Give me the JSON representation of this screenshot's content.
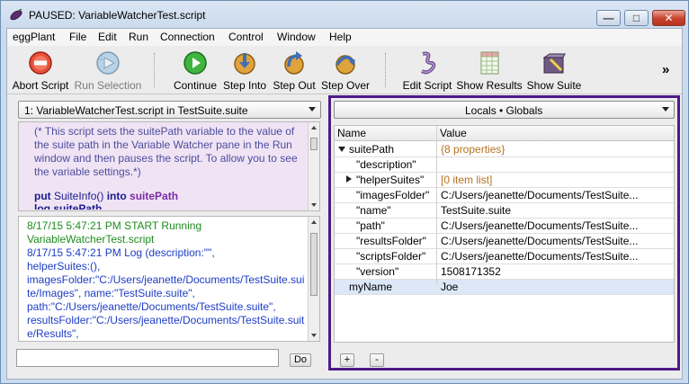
{
  "window": {
    "title": "PAUSED: VariableWatcherTest.script",
    "minimize_label": "—",
    "maximize_label": "□",
    "close_label": "✕"
  },
  "menu": [
    "eggPlant",
    "File",
    "Edit",
    "Run",
    "Connection",
    "Control",
    "Window",
    "Help"
  ],
  "toolbar": {
    "abort": "Abort Script",
    "run_selection": "Run Selection",
    "continue": "Continue",
    "step_into": "Step Into",
    "step_out": "Step Out",
    "step_over": "Step Over",
    "edit_script": "Edit Script",
    "show_results": "Show Results",
    "show_suite": "Show Suite",
    "more": "»"
  },
  "script_selector": {
    "value": "1: VariableWatcherTest.script in TestSuite.suite"
  },
  "script": {
    "comment": "(* This script sets the suitePath variable to the value of the suite path in the Variable Watcher pane in the Run window and then pauses the script. To allow you to see the variable settings.*)",
    "code_kw_put": "put",
    "code_func": "SuiteInfo()",
    "code_kw_into": "into",
    "code_var": "suitePath",
    "code_next": "log suitePath"
  },
  "log": {
    "lines": [
      {
        "text": "8/17/15 5:47:21 PM        START                 Running",
        "color": "green"
      },
      {
        "text": "VariableWatcherTest.script",
        "color": "green"
      },
      {
        "text": "8/17/15 5:47:21 PM        Log             (description:\"\",",
        "color": "blue"
      },
      {
        "text": "helperSuites:(),",
        "color": "blue"
      },
      {
        "text": "imagesFolder:\"C:/Users/jeanette/Documents/TestSuite.sui",
        "color": "blue"
      },
      {
        "text": "te/Images\", name:\"TestSuite.suite\",",
        "color": "blue"
      },
      {
        "text": "path:\"C:/Users/jeanette/Documents/TestSuite.suite\",",
        "color": "blue"
      },
      {
        "text": "resultsFolder:\"C:/Users/jeanette/Documents/TestSuite.suit",
        "color": "blue"
      },
      {
        "text": "e/Results\",",
        "color": "blue"
      }
    ]
  },
  "command": {
    "do_label": "Do"
  },
  "watcher": {
    "scope_selector": "Locals • Globals",
    "col_name": "Name",
    "col_value": "Value",
    "rows": [
      {
        "name": "suitePath",
        "value": "{8 properties}",
        "indent": 0,
        "toggle": "expanded",
        "value_color": "brown"
      },
      {
        "name": "\"description\"",
        "value": "",
        "indent": 1
      },
      {
        "name": "\"helperSuites\"",
        "value": "[0 item list]",
        "indent": 1,
        "toggle": "collapsed",
        "value_color": "brown"
      },
      {
        "name": "\"imagesFolder\"",
        "value": "C:/Users/jeanette/Documents/TestSuite...",
        "indent": 1
      },
      {
        "name": "\"name\"",
        "value": "TestSuite.suite",
        "indent": 1
      },
      {
        "name": "\"path\"",
        "value": "C:/Users/jeanette/Documents/TestSuite...",
        "indent": 1
      },
      {
        "name": "\"resultsFolder\"",
        "value": "C:/Users/jeanette/Documents/TestSuite...",
        "indent": 1
      },
      {
        "name": "\"scriptsFolder\"",
        "value": "C:/Users/jeanette/Documents/TestSuite...",
        "indent": 1
      },
      {
        "name": "\"version\"",
        "value": "1508171352",
        "indent": 1
      },
      {
        "name": "myName",
        "value": "Joe",
        "indent": 0,
        "selected": true
      }
    ],
    "add_label": "+",
    "remove_label": "-"
  }
}
